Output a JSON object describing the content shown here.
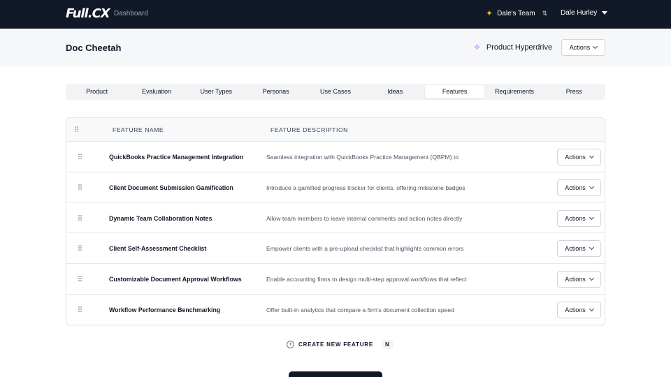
{
  "nav": {
    "logo": "Full.CX",
    "breadcrumb": "Dashboard",
    "team": "Dale's Team",
    "user": "Dale Hurley"
  },
  "header": {
    "title": "Doc Cheetah",
    "hyperdrive": "Product Hyperdrive",
    "actions_label": "Actions"
  },
  "tabs": [
    {
      "label": "Product"
    },
    {
      "label": "Evaluation"
    },
    {
      "label": "User Types"
    },
    {
      "label": "Personas"
    },
    {
      "label": "Use Cases"
    },
    {
      "label": "Ideas"
    },
    {
      "label": "Features",
      "active": true
    },
    {
      "label": "Requirements"
    },
    {
      "label": "Press"
    }
  ],
  "table": {
    "columns": [
      "FEATURE NAME",
      "FEATURE DESCRIPTION"
    ],
    "row_action_label": "Actions",
    "rows": [
      {
        "name": "QuickBooks Practice Management Integration",
        "description": "Seamless integration with QuickBooks Practice Management (QBPM) to"
      },
      {
        "name": "Client Document Submission Gamification",
        "description": "Introduce a gamified progress tracker for clients, offering milestone badges"
      },
      {
        "name": "Dynamic Team Collaboration Notes",
        "description": "Allow team members to leave internal comments and action notes directly"
      },
      {
        "name": "Client Self-Assessment Checklist",
        "description": "Empower clients with a pre-upload checklist that highlights common errors"
      },
      {
        "name": "Customizable Document Approval Workflows",
        "description": "Enable accounting firms to design multi-step approval workflows that reflect"
      },
      {
        "name": "Workflow Performance Benchmarking",
        "description": "Offer built-in analytics that compare a firm's document collection speed"
      }
    ]
  },
  "create": {
    "label": "CREATE NEW FEATURE",
    "shortcut": "N"
  },
  "colors": {
    "nav_bg": "#111827",
    "accent_team": "#f5b700",
    "accent_hyper": "#a855f7"
  }
}
